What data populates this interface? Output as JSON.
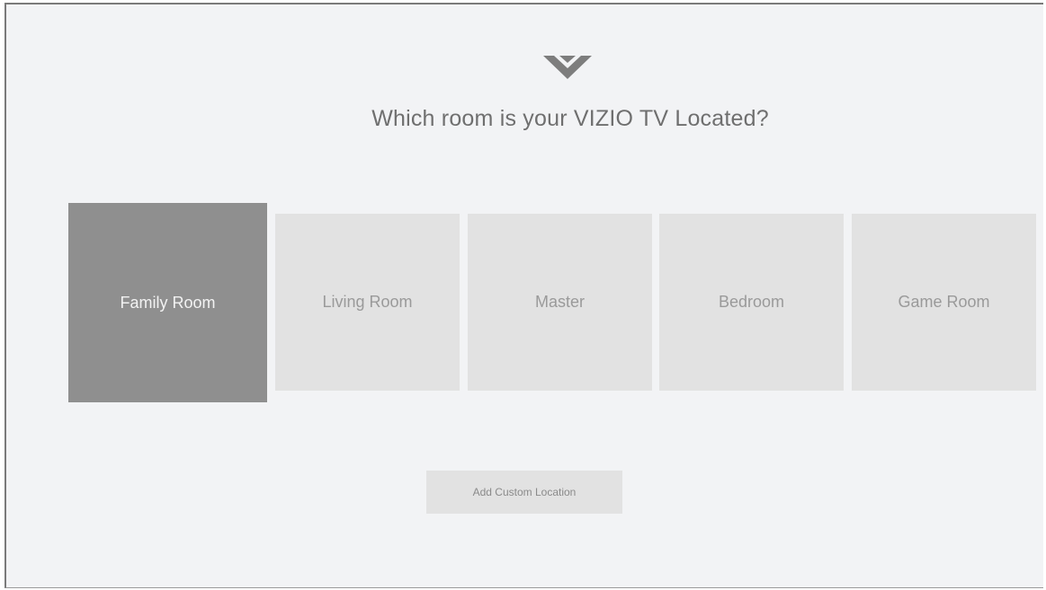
{
  "header": {
    "logo_icon": "vizio-v-logo-icon",
    "title": "Which room is your VIZIO TV Located?"
  },
  "rooms": [
    {
      "label": "Family Room",
      "selected": true
    },
    {
      "label": "Living Room",
      "selected": false
    },
    {
      "label": "Master",
      "selected": false
    },
    {
      "label": "Bedroom",
      "selected": false
    },
    {
      "label": "Game Room",
      "selected": false
    }
  ],
  "actions": {
    "add_custom_label": "Add Custom Location"
  },
  "colors": {
    "background": "#f2f3f5",
    "tile": "#e2e2e2",
    "tile_selected": "#8f8f8f",
    "title_text": "#6f6f6f"
  }
}
